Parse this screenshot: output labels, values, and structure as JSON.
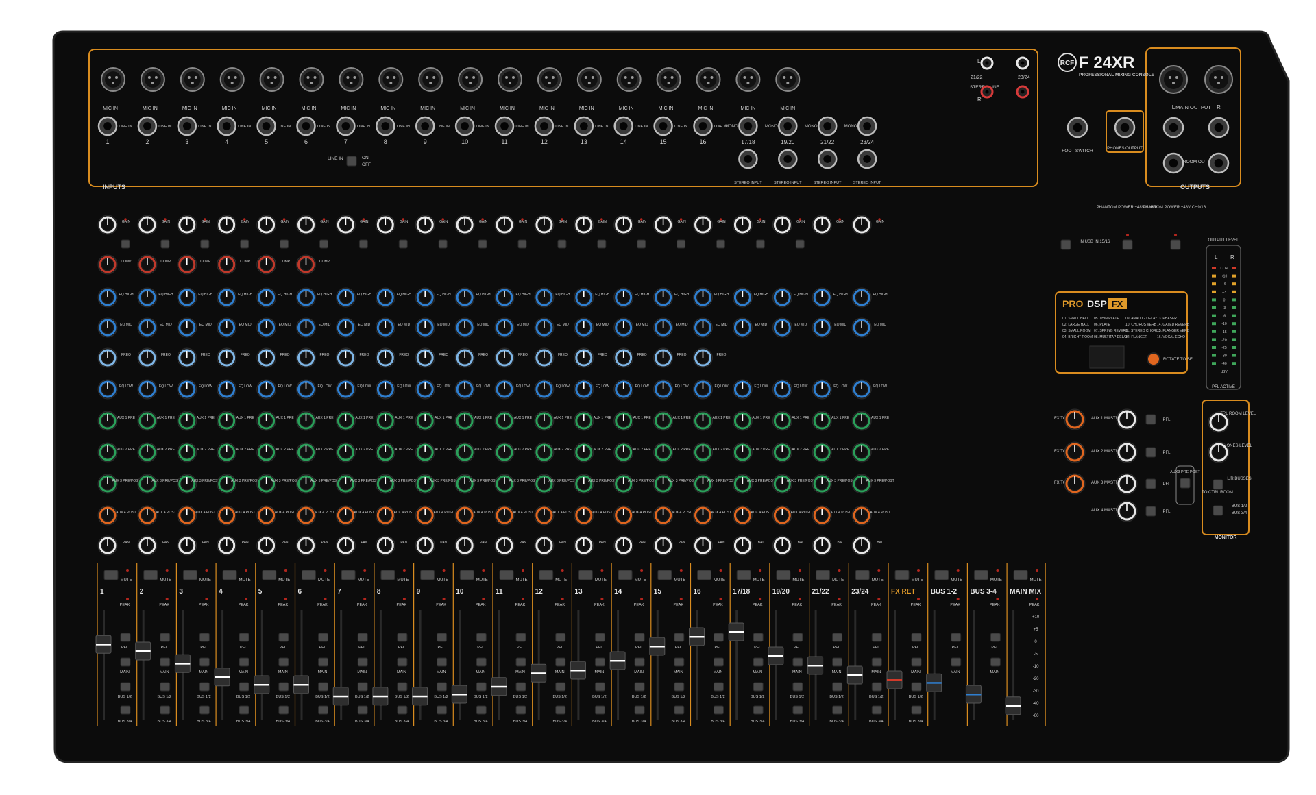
{
  "brand": {
    "logo": "RCF",
    "model": "F 24XR",
    "tagline": "PROFESSIONAL MIXING CONSOLE"
  },
  "colors": {
    "panel": "#0c0c0c",
    "outline": "#d98c1f",
    "knob_white": "#e8e8e8",
    "knob_red": "#c0392b",
    "knob_blue": "#2f7fd0",
    "knob_lightblue": "#7fb6e6",
    "knob_green": "#2aa05a",
    "knob_orange": "#e0661f",
    "text": "#d8d8d8"
  },
  "inputs": {
    "section_label": "INPUTS",
    "mic_label": "MIC IN",
    "line_label": "LINE IN",
    "mono_label": "MONO",
    "channels": [
      "1",
      "2",
      "3",
      "4",
      "5",
      "6",
      "7",
      "8",
      "9",
      "10",
      "11",
      "12",
      "13",
      "14",
      "15",
      "16",
      "17/18",
      "19/20",
      "21/22",
      "23/24"
    ],
    "stereo_input_label": "STEREO INPUT",
    "stereo_line_label": "STEREO LINE",
    "line_hiz_label": "LINE IN Hi-Z",
    "on_label": "ON",
    "off_label": "OFF",
    "rca_pairs": [
      "21/22",
      "23/24"
    ],
    "L": "L",
    "R": "R"
  },
  "rear": {
    "foot_switch": "FOOT SWITCH",
    "phones_output": "PHONES OUTPUT"
  },
  "outputs": {
    "section_label": "OUTPUTS",
    "main_output": "MAIN OUTPUT",
    "ctrl_room_output": "CTRL ROOM OUTPUT",
    "L": "L",
    "R": "R"
  },
  "knob_labels": {
    "gain": "GAIN",
    "comp": "COMP",
    "eq_high": "EQ HIGH",
    "eq_mid": "EQ MID",
    "freq": "FREQ",
    "eq_low": "EQ LOW",
    "aux1": "AUX 1 PRE",
    "aux2": "AUX 2 PRE",
    "aux3": "AUX 3 PRE/POST",
    "aux4": "AUX 4 POST",
    "pan": "PAN",
    "bal": "BAL"
  },
  "phantom": {
    "p1": "PHANTOM POWER +48V CH1/8",
    "p2": "PHANTOM POWER +48V CH9/16",
    "in_usb": "IN USB IN 15/16"
  },
  "dsp": {
    "title_pro": "PRO",
    "title_dsp": "DSP",
    "title_fx": "FX",
    "presets": [
      "01. SMALL HALL",
      "02. LARGE HALL",
      "03. SMALL ROOM",
      "04. BRIGHT ROOM",
      "05. THIN PLATE",
      "06. PLATE",
      "07. SPRING REVERB",
      "08. MULTITAP DELAY",
      "09. ANALOG DELAY",
      "10. CHORUS VERB",
      "11. STEREO CHORUS",
      "12. FLANGER",
      "13. PHASER",
      "14. GATED REVERB",
      "15. FLANGER VERB",
      "16. VOCAL ECHO"
    ],
    "rotate_label": "ROTATE TO SEL"
  },
  "meter": {
    "title": "OUTPUT LEVEL",
    "L": "L",
    "R": "R",
    "scale": [
      "CLIP",
      "+10",
      "+6",
      "+3",
      "0",
      "-3",
      "-6",
      "-10",
      "-15",
      "-20",
      "-25",
      "-30",
      "-40",
      "dBV"
    ],
    "pfl_active": "PFL ACTIVE"
  },
  "monitor": {
    "section_label": "MONITOR",
    "ctrl_room_level": "CTRL ROOM LEVEL",
    "phones_level": "PHONES LEVEL",
    "to_ctrl_room": "TO CTRL ROOM",
    "lr_busses": "L/R BUSSES",
    "bus12": "BUS 1/2",
    "bus34": "BUS 3/4"
  },
  "masters": {
    "fx_to_aux1": "FX TO AUX 1",
    "fx_to_aux2": "FX TO AUX 2",
    "fx_to_aux3": "FX TO AUX 3",
    "aux1_master": "AUX 1 MASTER",
    "aux2_master": "AUX 2 MASTER",
    "aux3_master": "AUX 3 MASTER",
    "aux4_master": "AUX 4 MASTER",
    "pfl": "PFL",
    "aux3_pre_post": "AUX3 PRE POST"
  },
  "strips": {
    "mute": "MUTE",
    "peak": "PEAK",
    "pfl": "PFL",
    "main": "MAIN",
    "bus12": "BUS 1/2",
    "bus34": "BUS 3/4",
    "names": [
      "1",
      "2",
      "3",
      "4",
      "5",
      "6",
      "7",
      "8",
      "9",
      "10",
      "11",
      "12",
      "13",
      "14",
      "15",
      "16",
      "17/18",
      "19/20",
      "21/22",
      "23/24",
      "FX RET",
      "BUS 1-2",
      "BUS 3-4",
      "MAIN MIX"
    ],
    "fader_levels": [
      0.72,
      0.65,
      0.52,
      0.38,
      0.3,
      0.3,
      0.18,
      0.18,
      0.18,
      0.2,
      0.28,
      0.42,
      0.45,
      0.55,
      0.7,
      0.8,
      0.85,
      0.6,
      0.5,
      0.4,
      0.35,
      0.32,
      0.2,
      0.08
    ],
    "main_scale": [
      "+10",
      "+5",
      "0",
      "-5",
      "-10",
      "-20",
      "-30",
      "-40",
      "-60"
    ]
  }
}
